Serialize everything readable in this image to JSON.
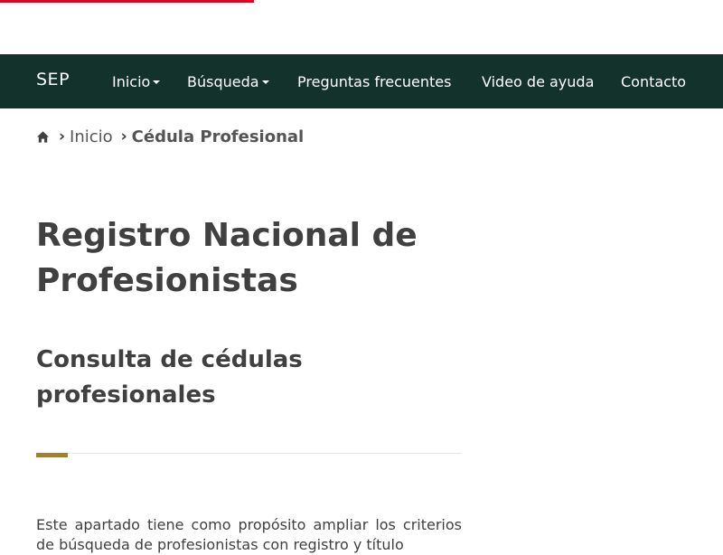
{
  "colors": {
    "top_accent": "#d10a2b",
    "navbar_bg": "#13322b",
    "gold_accent": "#a57f2c",
    "text": "#404041"
  },
  "navbar": {
    "brand": "SEP",
    "items": [
      {
        "label": "Inicio",
        "dropdown": true
      },
      {
        "label": "Búsqueda",
        "dropdown": true
      },
      {
        "label": "Preguntas frecuentes",
        "dropdown": false
      },
      {
        "label": "Video de ayuda",
        "dropdown": false
      },
      {
        "label": "Contacto",
        "dropdown": false
      }
    ]
  },
  "breadcrumb": {
    "home_icon": "home-icon",
    "separator": "›",
    "items": [
      "Inicio",
      "Cédula Profesional"
    ]
  },
  "main": {
    "title": "Registro Nacional de Profesionistas",
    "subtitle": "Consulta de cédulas profesionales",
    "intro": "Este apartado tiene como propósito ampliar los criterios de búsqueda de profesionistas con registro y título"
  }
}
